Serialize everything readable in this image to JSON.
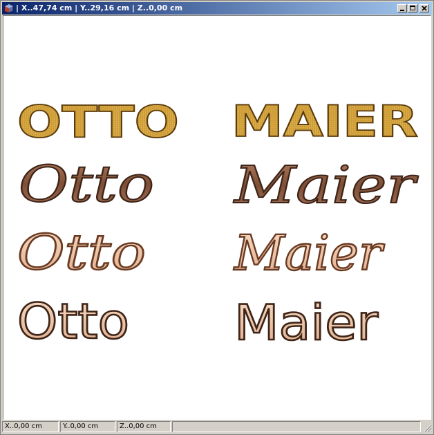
{
  "window": {
    "title": "| X..47,74 cm | Y..29,16 cm | Z..0,00 cm",
    "icon": "cube-icon",
    "controls": [
      "minimize-icon",
      "maximize-icon",
      "close-icon"
    ]
  },
  "lettering": [
    {
      "text": "OTTO",
      "style": "gold-brushed-blocky-caps"
    },
    {
      "text": "MAIER",
      "style": "gold-brushed-blocky-caps"
    },
    {
      "text": "Otto",
      "style": "bronze-solid-italic"
    },
    {
      "text": "Maier",
      "style": "bronze-solid-italic"
    },
    {
      "text": "Otto",
      "style": "bronze-outline-italic"
    },
    {
      "text": "Maier",
      "style": "bronze-outline-italic"
    },
    {
      "text": "Otto",
      "style": "bronze-outline-upright"
    },
    {
      "text": "Maier",
      "style": "bronze-outline-upright"
    }
  ],
  "colors": {
    "gold": "#d7a83a",
    "gold_edge": "#5a3a0a",
    "bronze": "#8a5a3e",
    "bronze_edge": "#3e2418",
    "bronze_light": "#f0c8ac",
    "titlebar_start": "#0a246a",
    "titlebar_end": "#a6caf0"
  },
  "status": {
    "x": "X..0,00 cm",
    "y": "Y..0,00 cm",
    "z": "Z..0,00 cm",
    "extra": ""
  }
}
